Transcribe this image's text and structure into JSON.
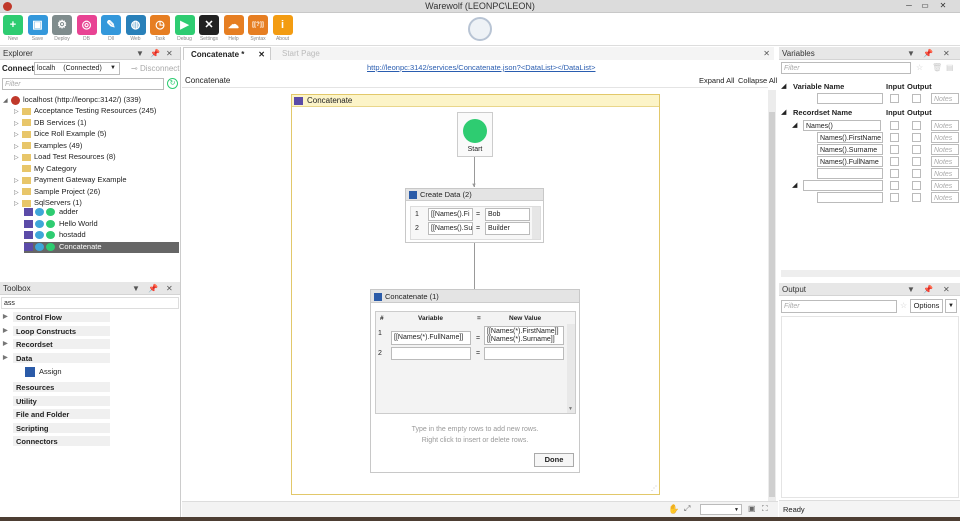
{
  "window": {
    "title": "Warewolf (LEONPC\\LEON)"
  },
  "ribbon": {
    "buttons": [
      {
        "label": "New",
        "color": "#2ecc71",
        "glyph": "+"
      },
      {
        "label": "Save",
        "color": "#3498db",
        "glyph": "▣"
      },
      {
        "label": "Deploy",
        "color": "#7f8c8d",
        "glyph": "⚙"
      },
      {
        "label": "DB",
        "color": "#e84393",
        "glyph": "◎"
      },
      {
        "label": "Dll",
        "color": "#3498db",
        "glyph": "✎"
      },
      {
        "label": "Web",
        "color": "#2980b9",
        "glyph": "◍"
      },
      {
        "label": "Task",
        "color": "#e67e22",
        "glyph": "◷"
      },
      {
        "label": "Debug",
        "color": "#2ecc71",
        "glyph": "▶"
      },
      {
        "label": "Settings",
        "color": "#222222",
        "glyph": "✕"
      },
      {
        "label": "Help",
        "color": "#e67e22",
        "glyph": "☁"
      },
      {
        "label": "Syntax",
        "color": "#e67e22",
        "glyph": "[[?]]"
      },
      {
        "label": "About",
        "color": "#f39c12",
        "glyph": "i"
      }
    ]
  },
  "explorer": {
    "title": "Explorer",
    "connect_label": "Connect:",
    "server_value": "localh",
    "status": "(Connected)",
    "disconnect": "Disconnect",
    "filter_placeholder": "Filter",
    "root": "localhost (http://leonpc:3142/) (339)",
    "folders": [
      "Acceptance Testing Resources (245)",
      "DB Services (1)",
      "Dice Roll Example (5)",
      "Examples (49)",
      "Load Test Resources (8)",
      "My Category",
      "Payment Gateway Example",
      "Sample Project (26)",
      "SqlServers (1)"
    ],
    "services": [
      "adder",
      "Hello World",
      "hostadd",
      "Concatenate"
    ]
  },
  "toolbox": {
    "title": "Toolbox",
    "search_value": "ass",
    "categories_top": [
      "Control Flow",
      "Loop Constructs",
      "Recordset",
      "Data"
    ],
    "tool": "Assign",
    "categories_bottom": [
      "Resources",
      "Utility",
      "File and Folder",
      "Scripting",
      "Connectors"
    ]
  },
  "tabs": {
    "active": "Concatenate *",
    "inactive": "Start Page"
  },
  "designer": {
    "url": "http://leonpc:3142/services/Concatenate.json?<DataList></DataList>",
    "breadcrumb": "Concatenate",
    "expand_all": "Expand All",
    "collapse_all": "Collapse All",
    "flow_title": "Concatenate",
    "start_label": "Start",
    "create_data": {
      "title": "Create Data (2)",
      "rows": [
        {
          "num": "1",
          "var": "[[Names().Fi",
          "eq": "=",
          "val": "Bob"
        },
        {
          "num": "2",
          "var": "[[Names().Su",
          "eq": "=",
          "val": "Builder"
        }
      ]
    },
    "concat": {
      "title": "Concatenate (1)",
      "col_num": "#",
      "col_var": "Variable",
      "col_eq": "=",
      "col_val": "New Value",
      "rows": [
        {
          "num": "1",
          "var": "[[Names(*).FullName]]",
          "eq": "=",
          "val1": "[[Names(*).FirstName]]",
          "val2": "[[Names(*).Surname]]"
        },
        {
          "num": "2",
          "var": "",
          "eq": "=",
          "val1": "",
          "val2": ""
        }
      ],
      "hint1": "Type in the empty rows to add new rows.",
      "hint2": "Right click to insert or delete rows.",
      "done": "Done"
    }
  },
  "variables": {
    "title": "Variables",
    "filter_placeholder": "Filter",
    "col_var": "Variable Name",
    "col_input": "Input",
    "col_output": "Output",
    "col_rs": "Recordset Name",
    "notes": "Notes",
    "recordset": "Names()",
    "fields": [
      "Names().FirstName",
      "Names().Surname",
      "Names().FullName"
    ]
  },
  "output": {
    "title": "Output",
    "filter_placeholder": "Filter",
    "options": "Options",
    "status": "Ready"
  }
}
